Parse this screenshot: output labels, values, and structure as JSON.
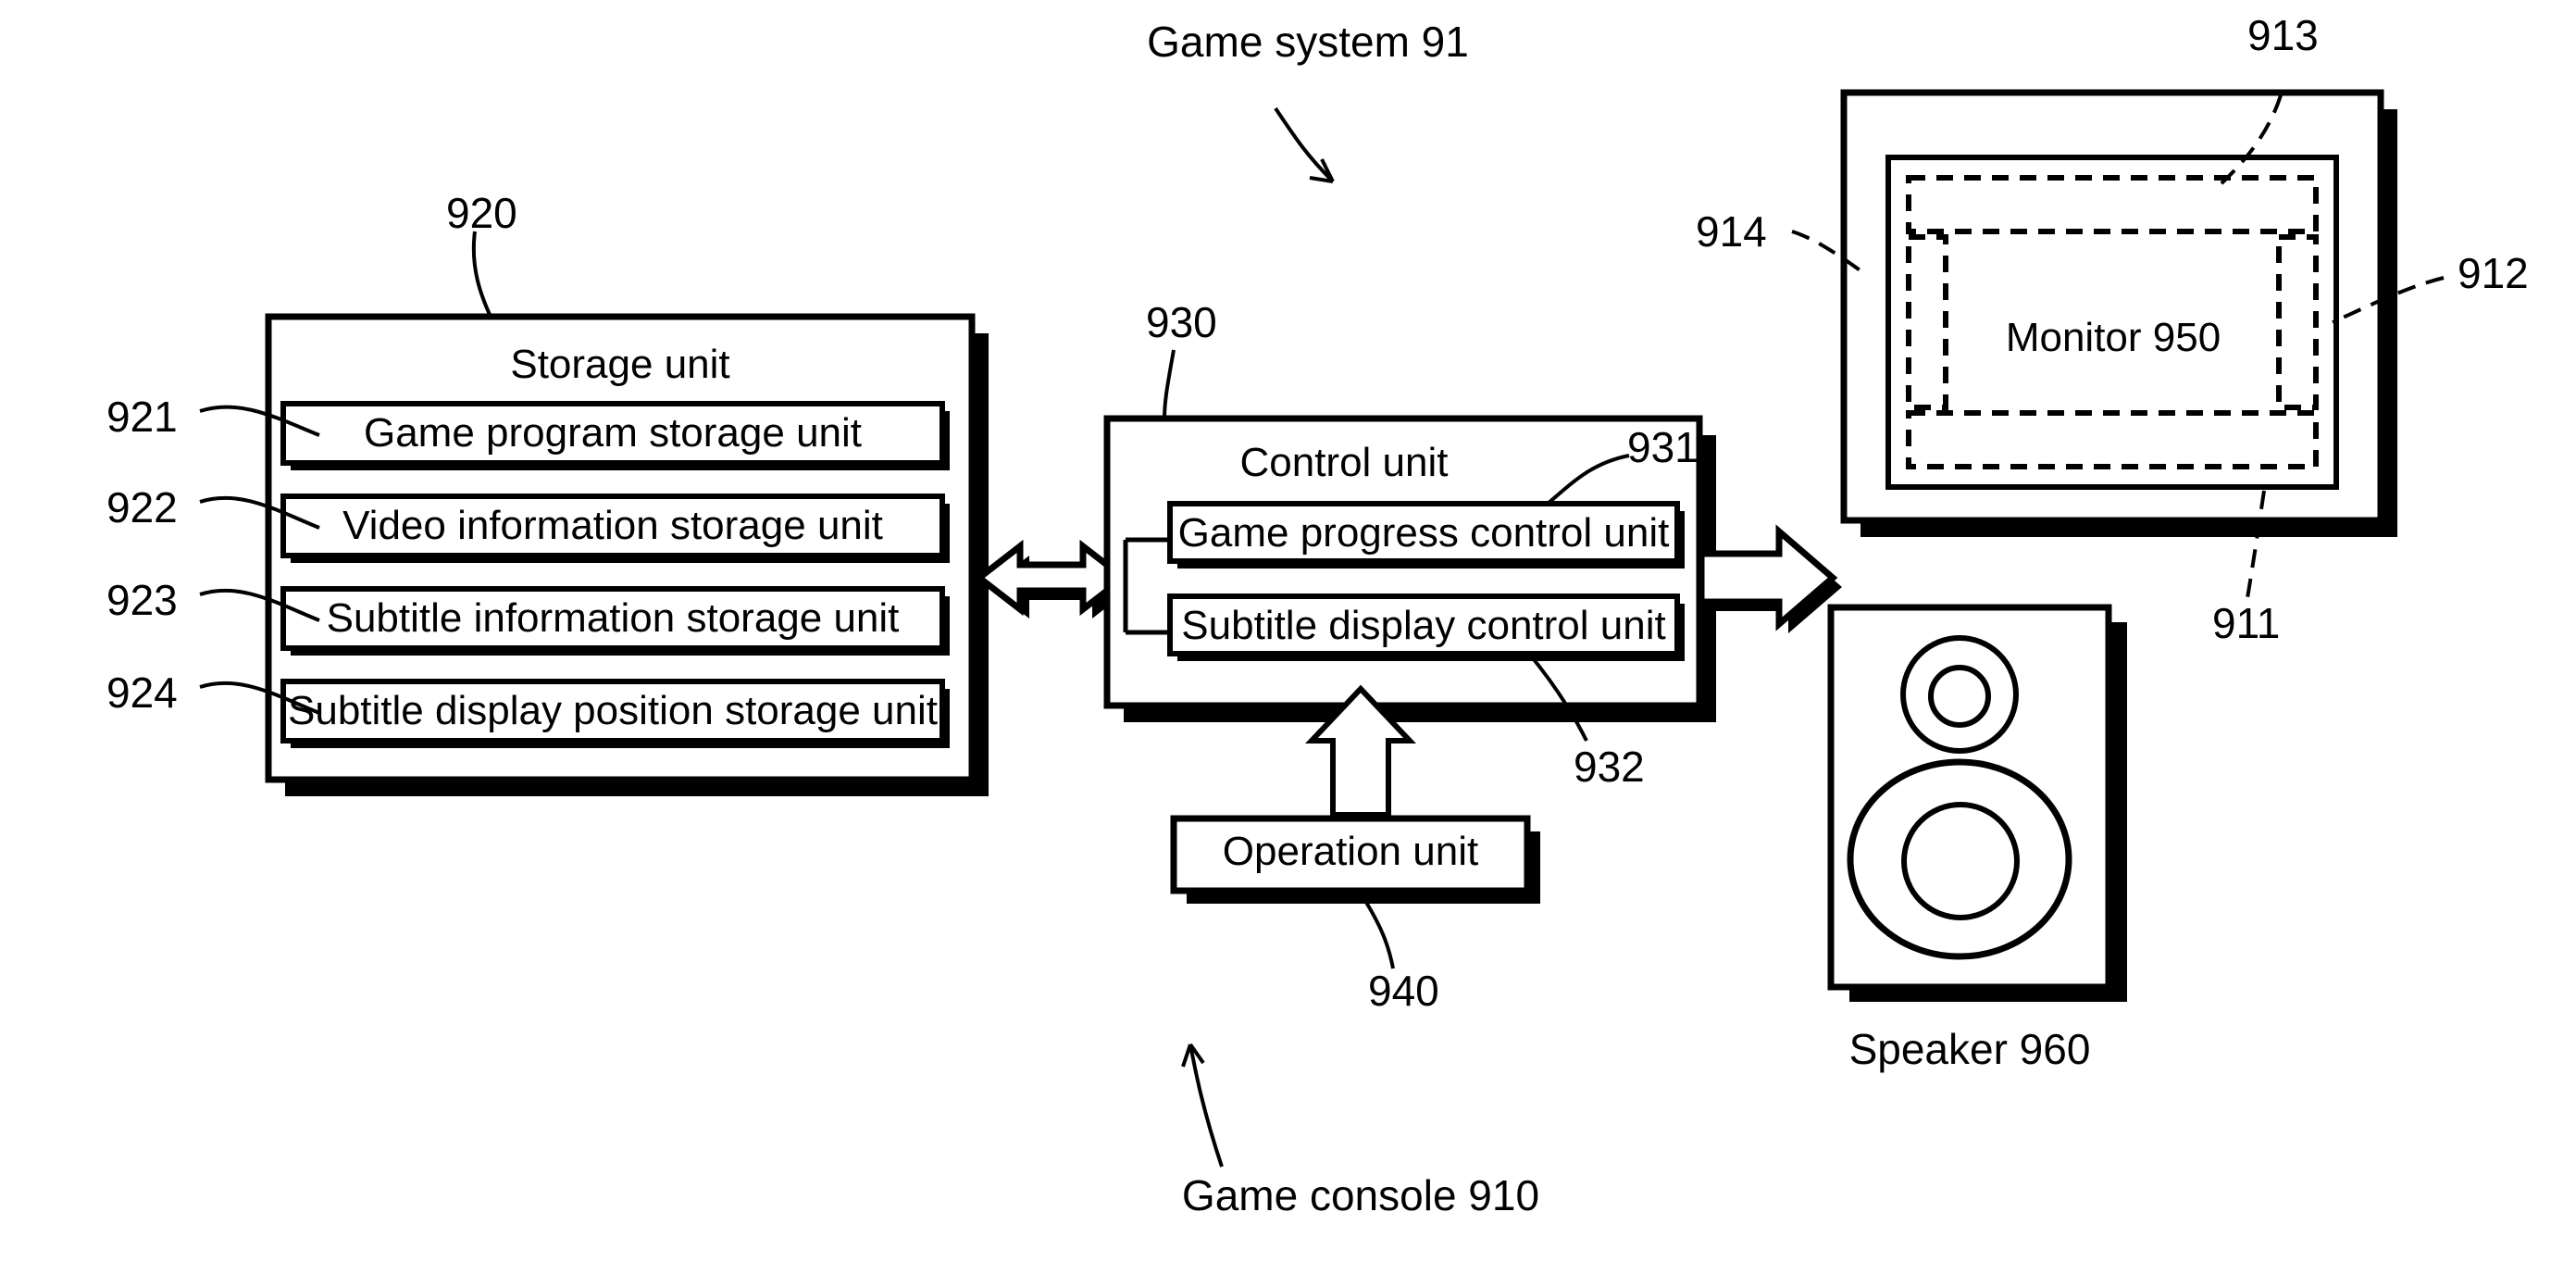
{
  "diagram": {
    "title": "Game system 91",
    "system_label": "Game system 91",
    "console_label": "Game console 910",
    "speaker_label": "Speaker 960",
    "monitor_label": "Monitor 950"
  },
  "storage_unit": {
    "ref": "920",
    "title": "Storage unit",
    "items": [
      {
        "ref": "921",
        "label": "Game program storage unit"
      },
      {
        "ref": "922",
        "label": "Video information storage unit"
      },
      {
        "ref": "923",
        "label": "Subtitle information storage unit"
      },
      {
        "ref": "924",
        "label": "Subtitle display position storage unit"
      }
    ]
  },
  "control_unit": {
    "ref": "930",
    "title": "Control unit",
    "items": [
      {
        "ref": "931",
        "label": "Game progress control unit"
      },
      {
        "ref": "932",
        "label": "Subtitle display control unit"
      }
    ]
  },
  "operation_unit": {
    "ref": "940",
    "label": "Operation unit"
  },
  "monitor": {
    "label": "Monitor 950",
    "regions": [
      {
        "ref": "913",
        "name": "top-subtitle-region"
      },
      {
        "ref": "912",
        "name": "right-subtitle-region"
      },
      {
        "ref": "911",
        "name": "bottom-subtitle-region"
      },
      {
        "ref": "914",
        "name": "left-subtitle-region"
      }
    ]
  },
  "speaker": {
    "label": "Speaker 960"
  },
  "colors": {
    "stroke": "#000000",
    "fill": "#ffffff",
    "shadow": "#000000"
  }
}
